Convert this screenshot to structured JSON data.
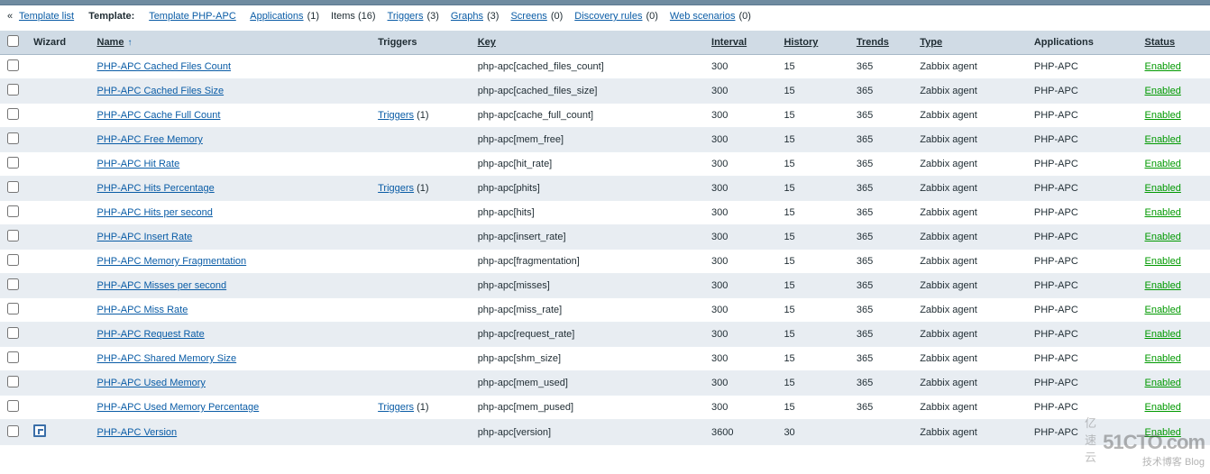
{
  "breadcrumb": {
    "back": "«",
    "template_list": "Template list",
    "template_label": "Template:",
    "template_name": "Template PHP-APC",
    "links": [
      {
        "label": "Applications",
        "count": "(1)"
      },
      {
        "label": "Items",
        "count": "(16)",
        "active": true
      },
      {
        "label": "Triggers",
        "count": "(3)"
      },
      {
        "label": "Graphs",
        "count": "(3)"
      },
      {
        "label": "Screens",
        "count": "(0)"
      },
      {
        "label": "Discovery rules",
        "count": "(0)"
      },
      {
        "label": "Web scenarios",
        "count": "(0)"
      }
    ]
  },
  "columns": {
    "wizard": "Wizard",
    "name": "Name",
    "triggers": "Triggers",
    "key": "Key",
    "interval": "Interval",
    "history": "History",
    "trends": "Trends",
    "type": "Type",
    "applications": "Applications",
    "status": "Status"
  },
  "sort_indicator": "↑",
  "rows": [
    {
      "name": "PHP-APC Cached Files Count",
      "triggers": "",
      "tcount": "",
      "key": "php-apc[cached_files_count]",
      "interval": "300",
      "history": "15",
      "trends": "365",
      "type": "Zabbix agent",
      "apps": "PHP-APC",
      "status": "Enabled"
    },
    {
      "name": "PHP-APC Cached Files Size",
      "triggers": "",
      "tcount": "",
      "key": "php-apc[cached_files_size]",
      "interval": "300",
      "history": "15",
      "trends": "365",
      "type": "Zabbix agent",
      "apps": "PHP-APC",
      "status": "Enabled"
    },
    {
      "name": "PHP-APC Cache Full Count",
      "triggers": "Triggers",
      "tcount": "(1)",
      "key": "php-apc[cache_full_count]",
      "interval": "300",
      "history": "15",
      "trends": "365",
      "type": "Zabbix agent",
      "apps": "PHP-APC",
      "status": "Enabled"
    },
    {
      "name": "PHP-APC Free Memory",
      "triggers": "",
      "tcount": "",
      "key": "php-apc[mem_free]",
      "interval": "300",
      "history": "15",
      "trends": "365",
      "type": "Zabbix agent",
      "apps": "PHP-APC",
      "status": "Enabled"
    },
    {
      "name": "PHP-APC Hit Rate",
      "triggers": "",
      "tcount": "",
      "key": "php-apc[hit_rate]",
      "interval": "300",
      "history": "15",
      "trends": "365",
      "type": "Zabbix agent",
      "apps": "PHP-APC",
      "status": "Enabled"
    },
    {
      "name": "PHP-APC Hits Percentage",
      "triggers": "Triggers",
      "tcount": "(1)",
      "key": "php-apc[phits]",
      "interval": "300",
      "history": "15",
      "trends": "365",
      "type": "Zabbix agent",
      "apps": "PHP-APC",
      "status": "Enabled"
    },
    {
      "name": "PHP-APC Hits per second",
      "triggers": "",
      "tcount": "",
      "key": "php-apc[hits]",
      "interval": "300",
      "history": "15",
      "trends": "365",
      "type": "Zabbix agent",
      "apps": "PHP-APC",
      "status": "Enabled"
    },
    {
      "name": "PHP-APC Insert Rate",
      "triggers": "",
      "tcount": "",
      "key": "php-apc[insert_rate]",
      "interval": "300",
      "history": "15",
      "trends": "365",
      "type": "Zabbix agent",
      "apps": "PHP-APC",
      "status": "Enabled"
    },
    {
      "name": "PHP-APC Memory Fragmentation",
      "triggers": "",
      "tcount": "",
      "key": "php-apc[fragmentation]",
      "interval": "300",
      "history": "15",
      "trends": "365",
      "type": "Zabbix agent",
      "apps": "PHP-APC",
      "status": "Enabled"
    },
    {
      "name": "PHP-APC Misses per second",
      "triggers": "",
      "tcount": "",
      "key": "php-apc[misses]",
      "interval": "300",
      "history": "15",
      "trends": "365",
      "type": "Zabbix agent",
      "apps": "PHP-APC",
      "status": "Enabled"
    },
    {
      "name": "PHP-APC Miss Rate",
      "triggers": "",
      "tcount": "",
      "key": "php-apc[miss_rate]",
      "interval": "300",
      "history": "15",
      "trends": "365",
      "type": "Zabbix agent",
      "apps": "PHP-APC",
      "status": "Enabled"
    },
    {
      "name": "PHP-APC Request Rate",
      "triggers": "",
      "tcount": "",
      "key": "php-apc[request_rate]",
      "interval": "300",
      "history": "15",
      "trends": "365",
      "type": "Zabbix agent",
      "apps": "PHP-APC",
      "status": "Enabled"
    },
    {
      "name": "PHP-APC Shared Memory Size",
      "triggers": "",
      "tcount": "",
      "key": "php-apc[shm_size]",
      "interval": "300",
      "history": "15",
      "trends": "365",
      "type": "Zabbix agent",
      "apps": "PHP-APC",
      "status": "Enabled"
    },
    {
      "name": "PHP-APC Used Memory",
      "triggers": "",
      "tcount": "",
      "key": "php-apc[mem_used]",
      "interval": "300",
      "history": "15",
      "trends": "365",
      "type": "Zabbix agent",
      "apps": "PHP-APC",
      "status": "Enabled"
    },
    {
      "name": "PHP-APC Used Memory Percentage",
      "triggers": "Triggers",
      "tcount": "(1)",
      "key": "php-apc[mem_pused]",
      "interval": "300",
      "history": "15",
      "trends": "365",
      "type": "Zabbix agent",
      "apps": "PHP-APC",
      "status": "Enabled"
    },
    {
      "name": "PHP-APC Version",
      "triggers": "",
      "tcount": "",
      "key": "php-apc[version]",
      "interval": "3600",
      "history": "30",
      "trends": "",
      "type": "Zabbix agent",
      "apps": "PHP-APC",
      "status": "Enabled",
      "wizard": true
    }
  ],
  "watermark": {
    "line1": "51CTO.com",
    "line2": "技术博客 Blog",
    "side": "亿速云"
  }
}
